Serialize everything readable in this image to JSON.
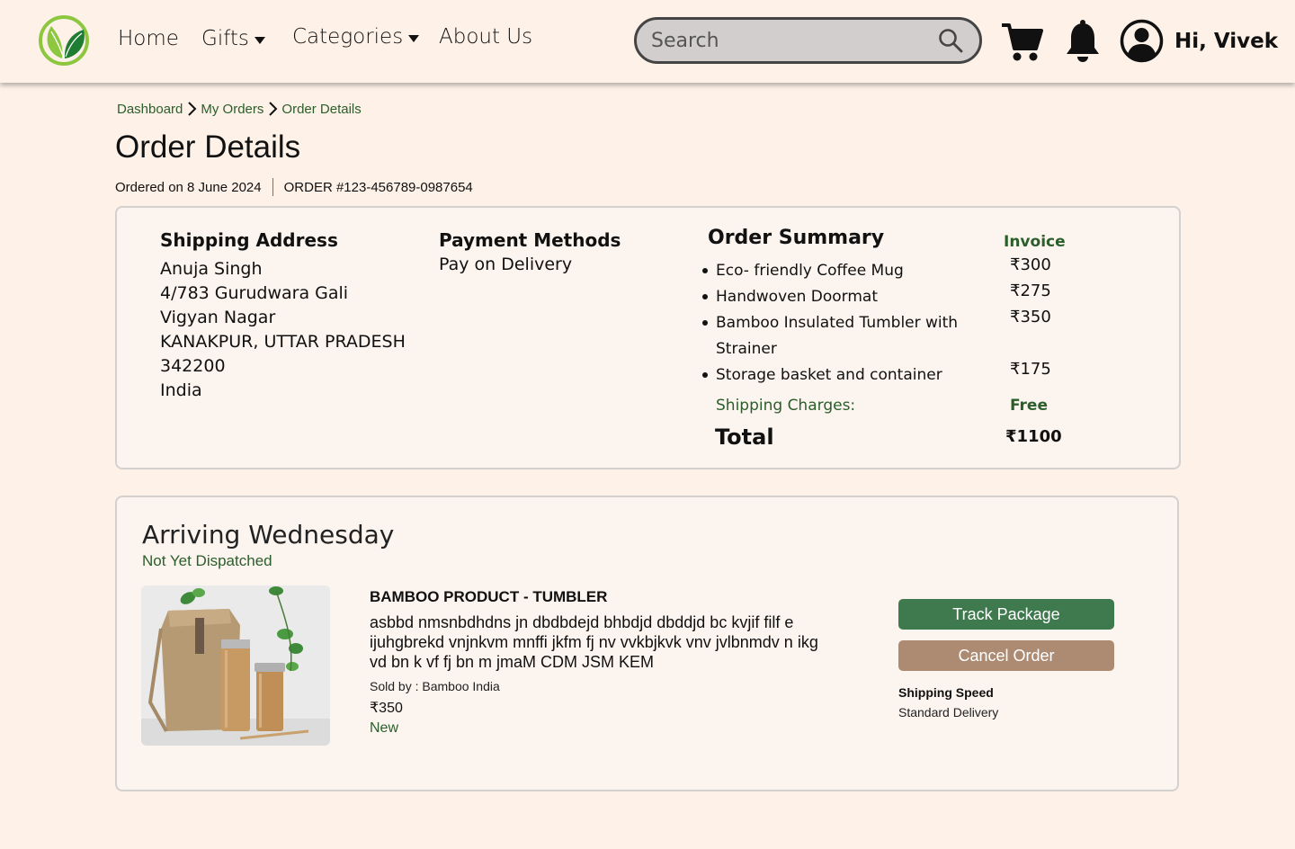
{
  "header": {
    "nav": [
      {
        "label": "Home"
      },
      {
        "label": "Gifts"
      },
      {
        "label": "Categories"
      },
      {
        "label": "About Us"
      }
    ],
    "search_placeholder": "Search",
    "greeting": "Hi, Vivek"
  },
  "breadcrumb": [
    "Dashboard",
    "My Orders",
    "Order Details"
  ],
  "page": {
    "title": "Order Details",
    "ordered_on": "Ordered on 8 June 2024",
    "order_number": "ORDER #123-456789-0987654"
  },
  "shipping": {
    "title": "Shipping Address",
    "lines": [
      "Anuja Singh",
      "4/783 Gurudwara Gali",
      "Vigyan Nagar",
      "KANAKPUR, UTTAR PRADESH",
      "342200",
      "India"
    ]
  },
  "payment": {
    "title": "Payment Methods",
    "method": "Pay on Delivery"
  },
  "summary": {
    "title": "Order Summary",
    "invoice_label": "Invoice",
    "items": [
      {
        "name": "Eco- friendly Coffee Mug",
        "price": "₹300"
      },
      {
        "name": "Handwoven Doormat",
        "price": "₹275"
      },
      {
        "name": "Bamboo Insulated Tumbler with Strainer",
        "price": "₹350"
      },
      {
        "name": "Storage basket and container",
        "price": "₹175"
      }
    ],
    "shipping_label": "Shipping Charges:",
    "shipping_value": "Free",
    "total_label": "Total",
    "total_value": "₹1100"
  },
  "shipment": {
    "arriving": "Arriving Wednesday",
    "status": "Not Yet Dispatched",
    "product_name": "BAMBOO PRODUCT - TUMBLER",
    "description": "asbbd nmsnbdhdns jn dbdbdejd bhbdjd dbddjd bc kvjif filf e ijuhgbrekd vnjnkvm mnffi jkfm fj  nv vvkbjkvk vnv jvlbnmdv  n ikg vd bn k  vf fj   bn m jmaM CDM JSM KEM",
    "sold_by": "Sold by : Bamboo India",
    "price": "₹350",
    "condition": "New",
    "track_label": "Track Package",
    "cancel_label": "Cancel Order",
    "speed_label": "Shipping Speed",
    "speed_value": "Standard Delivery"
  },
  "colors": {
    "background": "#fdf1e8",
    "card": "#fcf4ee",
    "accent_green": "#2a5e2a",
    "track_button": "#3f7a4f",
    "cancel_button": "#ad8b72"
  }
}
